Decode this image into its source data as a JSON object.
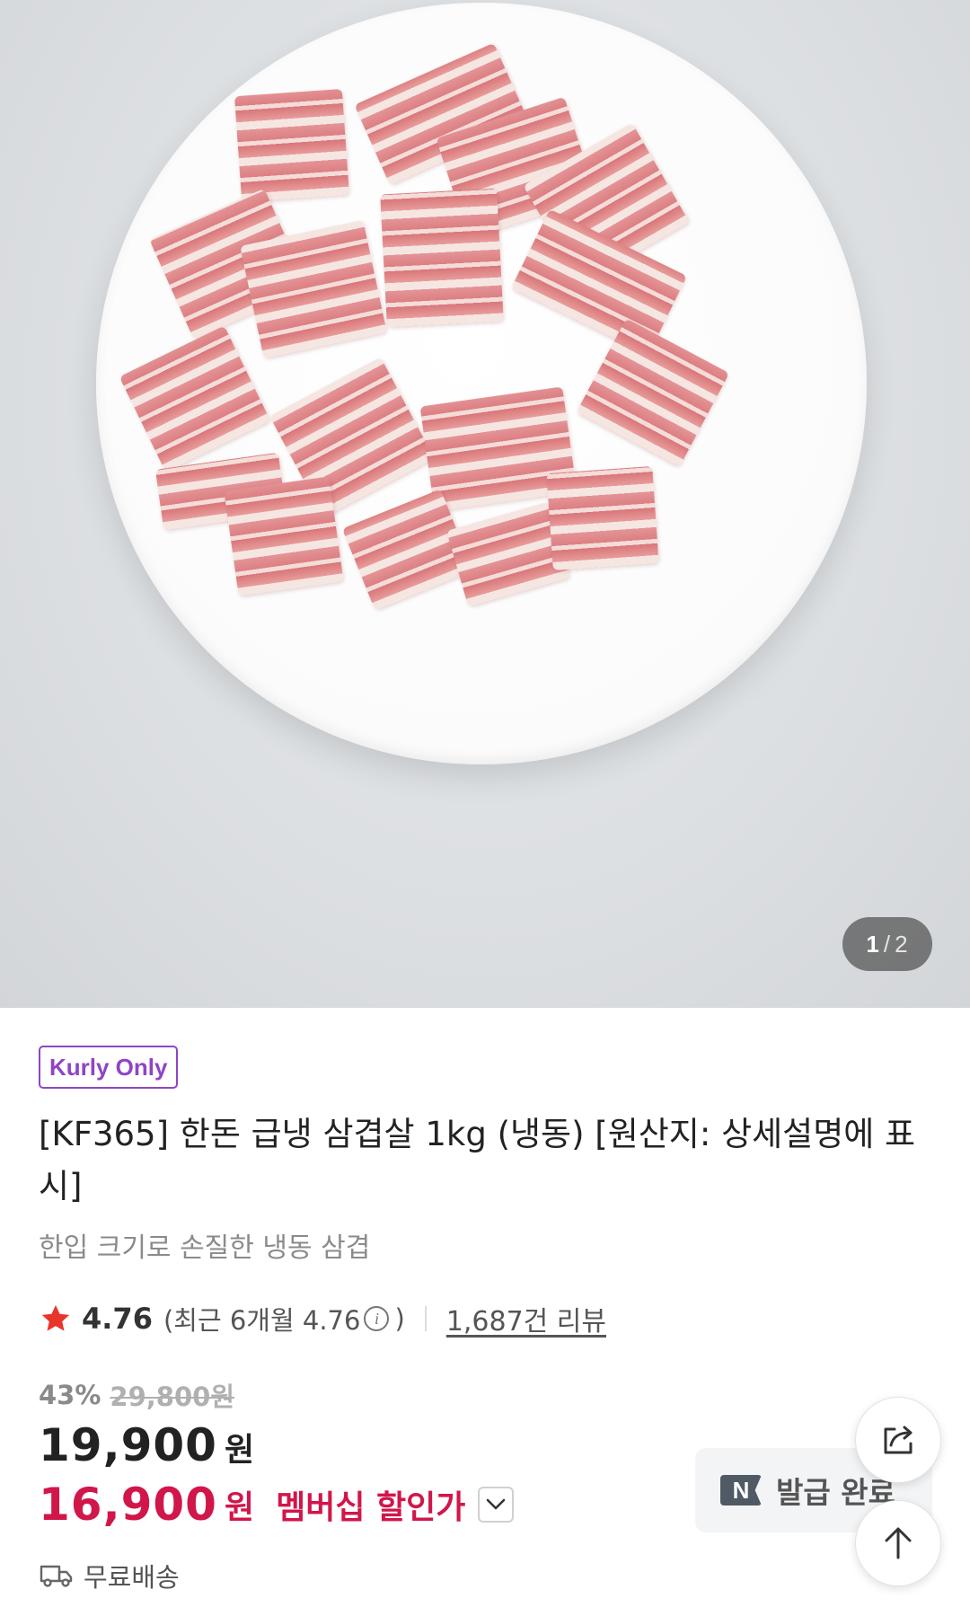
{
  "gallery": {
    "current_page": "1",
    "separator": "/",
    "total_pages": "2"
  },
  "product": {
    "tag": "Kurly Only",
    "title": "[KF365] 한돈 급냉 삼겹살 1kg (냉동) [원산지: 상세설명에 표시]",
    "subtitle": "한입 크기로 손질한 냉동 삼겹"
  },
  "rating": {
    "icon": "star-icon",
    "value": "4.76",
    "recent_prefix": "(최근 6개월 4.76",
    "recent_suffix": ")",
    "review_count_label": "1,687건 리뷰"
  },
  "pricing": {
    "discount_rate": "43%",
    "original_price": "29,800원",
    "price": "19,900",
    "price_unit": "원",
    "member_price": "16,900",
    "member_unit": "원",
    "member_label": "멤버십 할인가"
  },
  "delivery": {
    "icon": "truck-icon",
    "label": "무료배송"
  },
  "coupon": {
    "icon": "naver-n-icon",
    "label": "발급 완료"
  },
  "colors": {
    "accent_purple": "#8f44c6",
    "member_red": "#d1164a",
    "star_red": "#e8352b"
  }
}
